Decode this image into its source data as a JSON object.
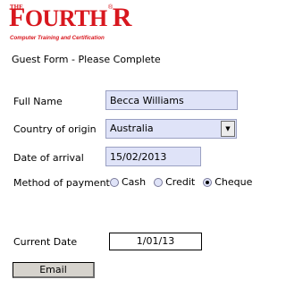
{
  "logo": {
    "the": "THE",
    "first_letter": "F",
    "rest": "OURTH ",
    "r": "R",
    "registered": "®",
    "subtitle": "Computer Training and Certification"
  },
  "form": {
    "title": "Guest Form - Please Complete",
    "full_name": {
      "label": "Full Name",
      "value": "Becca Williams"
    },
    "country": {
      "label": "Country of origin",
      "value": "Australia"
    },
    "arrival": {
      "label": "Date of arrival",
      "value": "15/02/2013"
    },
    "payment": {
      "label": "Method of payment",
      "options": [
        "Cash",
        "Credit",
        "Cheque"
      ],
      "selected": "Cheque"
    },
    "current_date": {
      "label": "Current Date",
      "value": "1/01/13"
    },
    "email_button": "Email"
  },
  "colors": {
    "brand_red": "#d8171e",
    "field_bg": "#dfe3f8",
    "button_bg": "#d6d3cd"
  },
  "icons": {
    "select_arrow": "triangle-down-icon"
  }
}
